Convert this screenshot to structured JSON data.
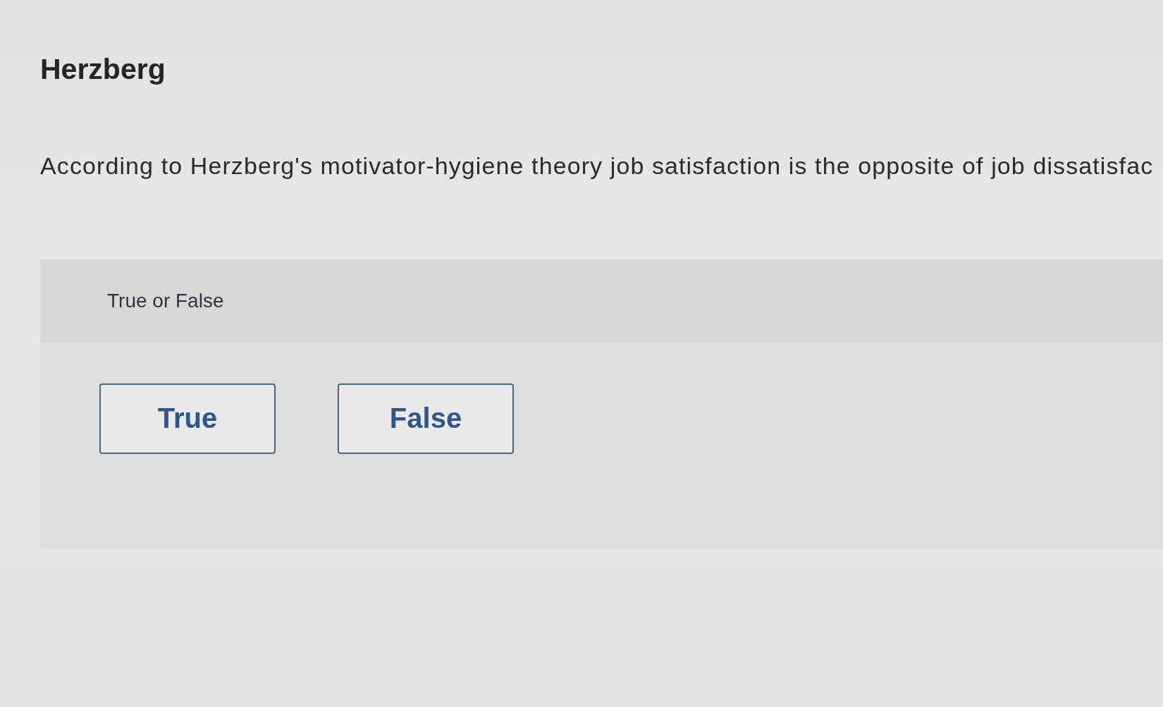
{
  "title": "Herzberg",
  "question": "According to Herzberg's motivator-hygiene theory job satisfaction is the opposite of job dissatisfac",
  "answer_panel": {
    "prompt": "True or False",
    "options": [
      {
        "label": "True",
        "selected": false
      },
      {
        "label": "False",
        "selected": false
      }
    ]
  }
}
